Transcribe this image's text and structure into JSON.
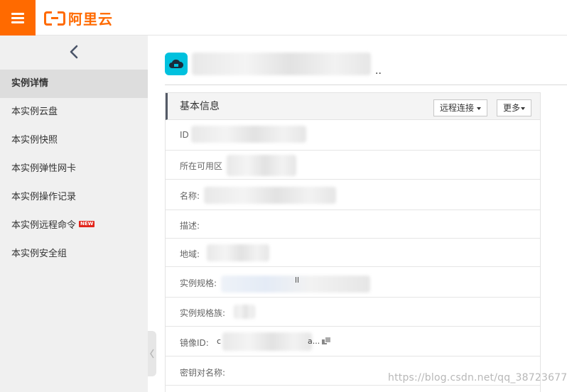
{
  "topbar": {
    "menu_icon": "hamburger-menu-icon",
    "logo_text": "阿里云",
    "brand_color": "#ff6a00"
  },
  "sidebar": {
    "collapse_icon": "chevron-left-icon",
    "items": [
      {
        "label": "实例详情",
        "active": true
      },
      {
        "label": "本实例云盘"
      },
      {
        "label": "本实例快照"
      },
      {
        "label": "本实例弹性网卡"
      },
      {
        "label": "本实例操作记录"
      },
      {
        "label": "本实例远程命令",
        "badge": "NEW"
      },
      {
        "label": "本实例安全组"
      }
    ],
    "expand_icon": "chevron-left-icon"
  },
  "main": {
    "instance_icon": "cloud-server-icon",
    "instance_name_suffix": "..",
    "panel": {
      "title": "基本信息",
      "remote_connect_label": "远程连接",
      "more_label": "更多",
      "rows": [
        {
          "label": "ID"
        },
        {
          "label": "所在可用区"
        },
        {
          "label": "名称:"
        },
        {
          "label": "描述:"
        },
        {
          "label": "地域:"
        },
        {
          "label": "实例规格:",
          "fragment": "ll"
        },
        {
          "label": "实例规格族:"
        },
        {
          "label": "镜像ID:",
          "fragment_start": "c",
          "fragment_end": "a..."
        },
        {
          "label": "密钥对名称:"
        }
      ]
    }
  },
  "watermark": "https://blog.csdn.net/qq_38723677"
}
